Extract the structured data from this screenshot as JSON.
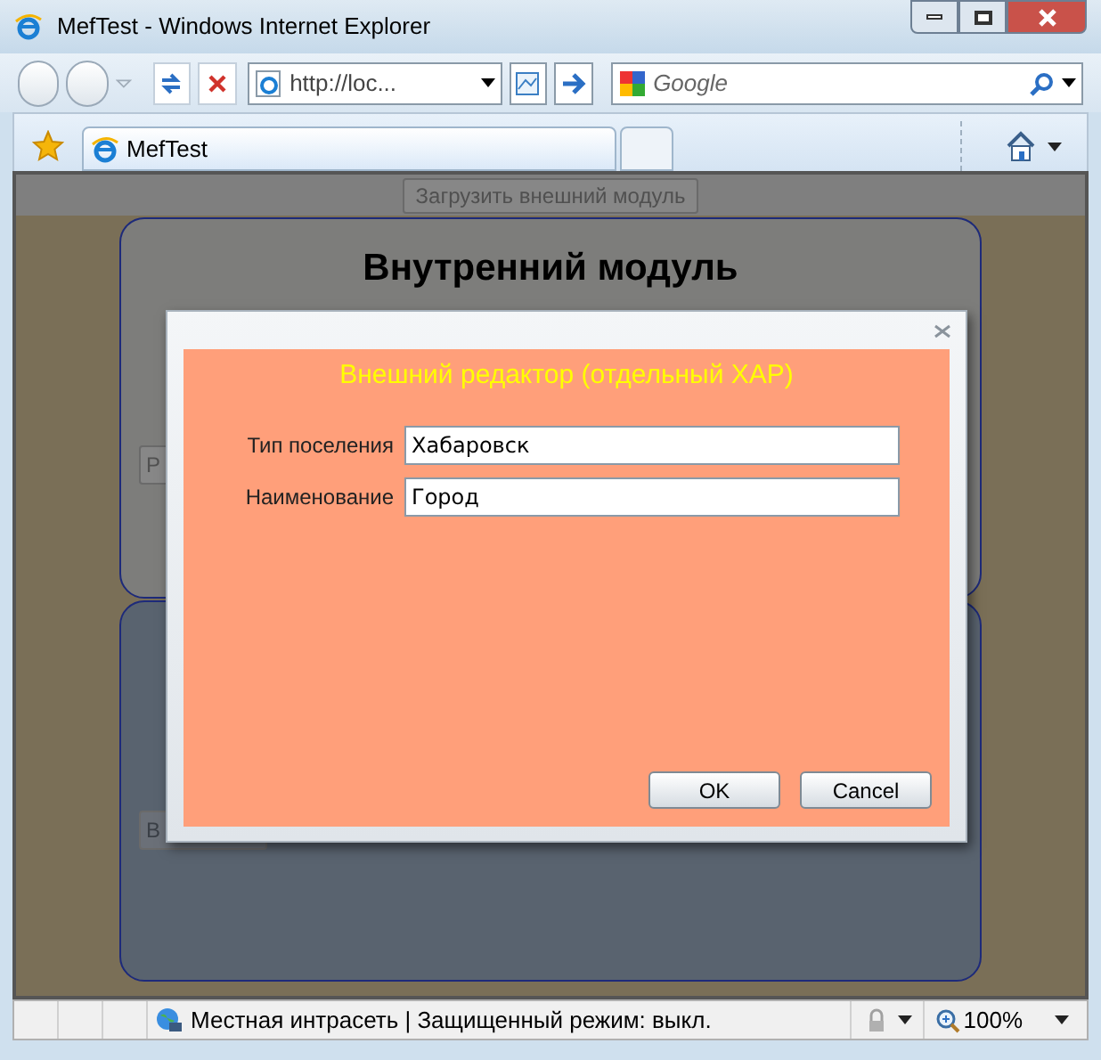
{
  "window": {
    "title": "MefTest - Windows Internet Explorer"
  },
  "address_bar": {
    "value": "http://loc..."
  },
  "search": {
    "placeholder": "Google"
  },
  "tabs": [
    {
      "kind": "page",
      "label": "MefTest",
      "selected": true
    },
    {
      "kind": "new",
      "selected": false
    }
  ],
  "page": {
    "load_button": "Загрузить внешний модуль",
    "inner_module": {
      "title": "Внутренний модуль",
      "button": "Р"
    },
    "lower_module": {
      "button": "В"
    }
  },
  "dialog": {
    "title": "Внешний редактор (отдельный XAP)",
    "fields": [
      {
        "label": "Тип поселения",
        "value": "Хабаровск"
      },
      {
        "label": "Наименование",
        "value": "Город"
      }
    ],
    "buttons": [
      "OK",
      "Cancel"
    ]
  },
  "status_bar": {
    "zone": "Местная интрасеть | Защищенный режим: выкл.",
    "zoom": "100%"
  }
}
